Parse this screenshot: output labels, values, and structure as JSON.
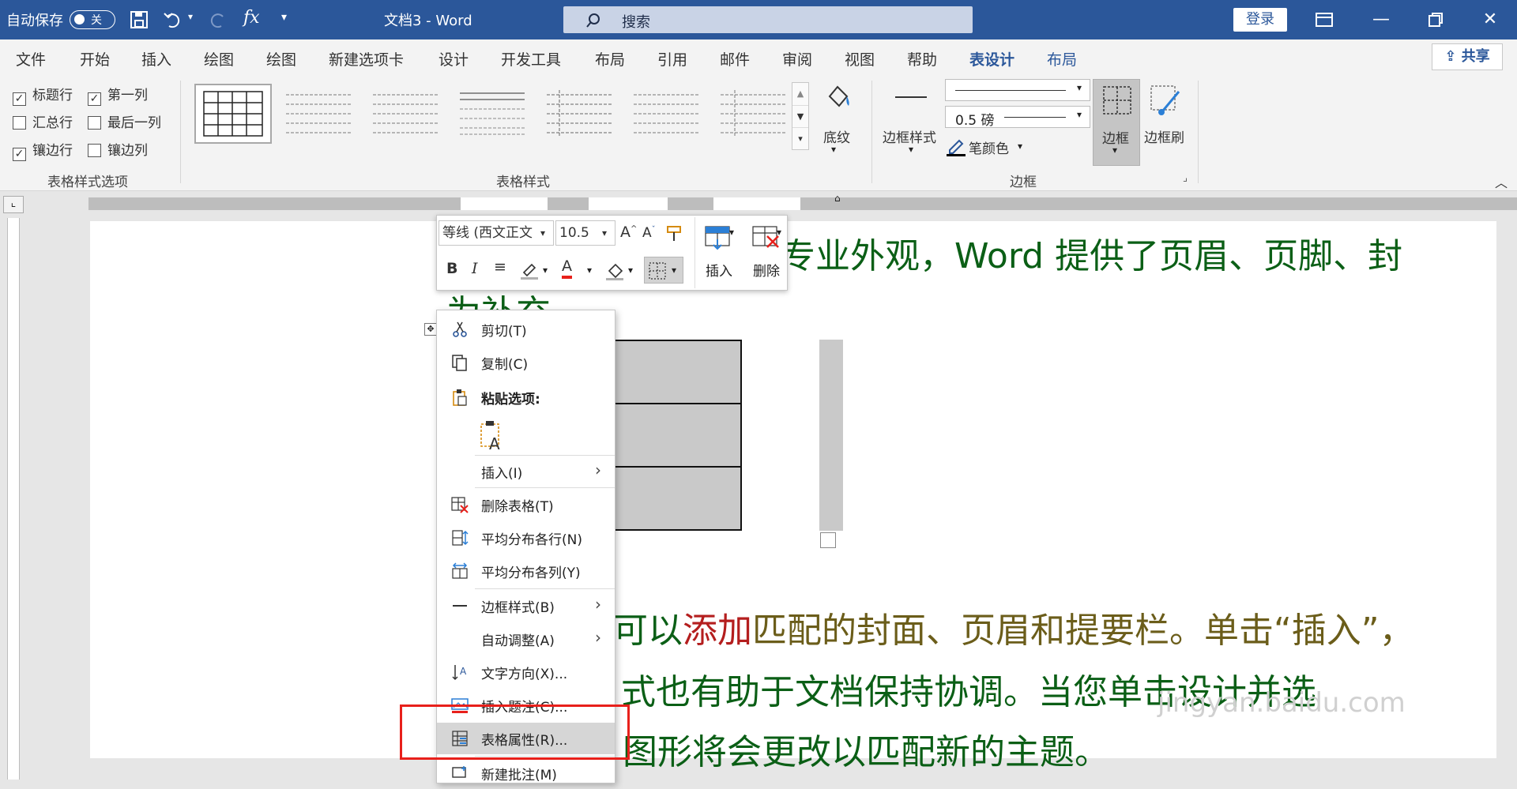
{
  "titlebar": {
    "autosave_label": "自动保存",
    "autosave_state": "关",
    "doc_title": "文档3  -  Word",
    "search_placeholder": "搜索",
    "login_label": "登录"
  },
  "tabs": [
    "文件",
    "开始",
    "插入",
    "绘图",
    "绘图",
    "新建选项卡",
    "设计",
    "开发工具",
    "布局",
    "引用",
    "邮件",
    "审阅",
    "视图",
    "帮助",
    "表设计",
    "布局"
  ],
  "active_tab": "表设计",
  "share_label": "共享",
  "ribbon": {
    "style_options": {
      "header_row": "标题行",
      "first_col": "第一列",
      "total_row": "汇总行",
      "last_col": "最后一列",
      "banded_rows": "镶边行",
      "banded_cols": "镶边列",
      "group_label": "表格样式选项"
    },
    "table_styles_label": "表格样式",
    "shading_label": "底纹",
    "border_styles_label": "边框样式",
    "pen_weight": "0.5 磅",
    "pen_color_label": "笔颜色",
    "borders_label": "边框",
    "border_painter_label": "边框刷",
    "borders_group_label": "边框"
  },
  "minitoolbar": {
    "font": "等线 (西文正文",
    "size": "10.5",
    "insert_label": "插入",
    "delete_label": "删除"
  },
  "context_menu": {
    "cut": "剪切(T)",
    "copy": "复制(C)",
    "paste_options": "粘贴选项:",
    "insert": "插入(I)",
    "delete_table": "删除表格(T)",
    "distribute_rows": "平均分布各行(N)",
    "distribute_cols": "平均分布各列(Y)",
    "border_styles": "边框样式(B)",
    "autofit": "自动调整(A)",
    "text_direction": "文字方向(X)...",
    "insert_caption": "插入题注(C)...",
    "table_properties": "表格属性(R)...",
    "new_comment": "新建批注(M)"
  },
  "document": {
    "line1": "专业外观，Word 提供了页眉、页脚、封",
    "line2": "为补充",
    "line3a": "可以",
    "line3b": "添加",
    "line3c": "匹配的封面、页眉和提要栏。单击“插入”，",
    "line4": "式也有助于文档保持协调。当您单击设计并选",
    "line5": "图形将会更改以匹配新的主题。"
  },
  "watermark": "jingyan.baidu.com",
  "colors": {
    "accent": "#2b579a",
    "doc_text": "#0b5f16",
    "highlight_box": "#e8201b"
  }
}
